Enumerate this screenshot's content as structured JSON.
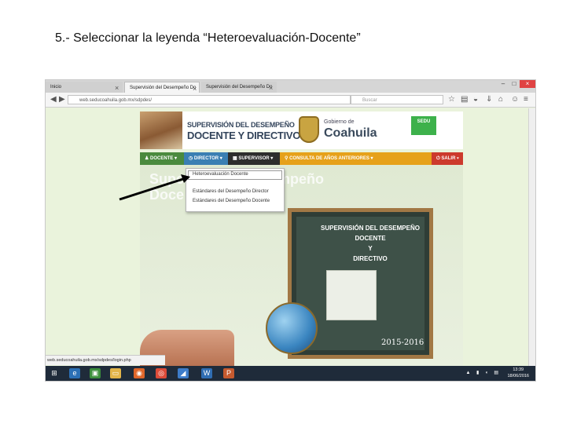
{
  "caption": "5.- Seleccionar la leyenda “Heteroevaluación-Docente”",
  "browser": {
    "tabs": [
      {
        "label": "Inicio"
      },
      {
        "label": "Supervisión del Desempeño Do"
      },
      {
        "label": "Supervisión del Desempeño Do"
      }
    ],
    "url": "web.seducoahuila.gob.mx/sdpdes/",
    "search_placeholder": "Buscar",
    "status_url": "web.seducoahuila.gob.mx/sdpdes/login.php"
  },
  "site": {
    "title_line1": "SUPERVISIÓN DEL DESEMPEÑO",
    "title_line2": "DOCENTE Y DIRECTIVO",
    "gob_small": "Gobierno de",
    "gob_big": "Coahuila",
    "sedu": "SEDU",
    "menu": {
      "docente": "DOCENTE",
      "director": "DIRECTOR",
      "supervisor": "SUPERVISOR",
      "consulta": "CONSULTA DE AÑOS ANTERIORES",
      "salir": "SALIR"
    },
    "dropdown": [
      "Heteroevaluación Docente",
      "Estándares del Desempeño Director",
      "Estándares del Desempeño Docente"
    ],
    "watermark_left_1": "Supe",
    "watermark_left_2": "Doce",
    "watermark_right": "empeño",
    "board": {
      "line1": "SUPERVISIÓN DEL DESEMPEÑO",
      "line2": "DOCENTE",
      "line3": "Y",
      "line4": "DIRECTIVO",
      "year": "2015-2016"
    }
  },
  "taskbar": {
    "time": "13:39",
    "date": "18/06/2016"
  },
  "colors": {
    "docente": "#4a8a3e",
    "director": "#3a7fb3",
    "supervisor": "#2d2d2d",
    "consulta": "#e6a11a",
    "salir": "#cc3a2c",
    "sedu": "#3db14b"
  }
}
